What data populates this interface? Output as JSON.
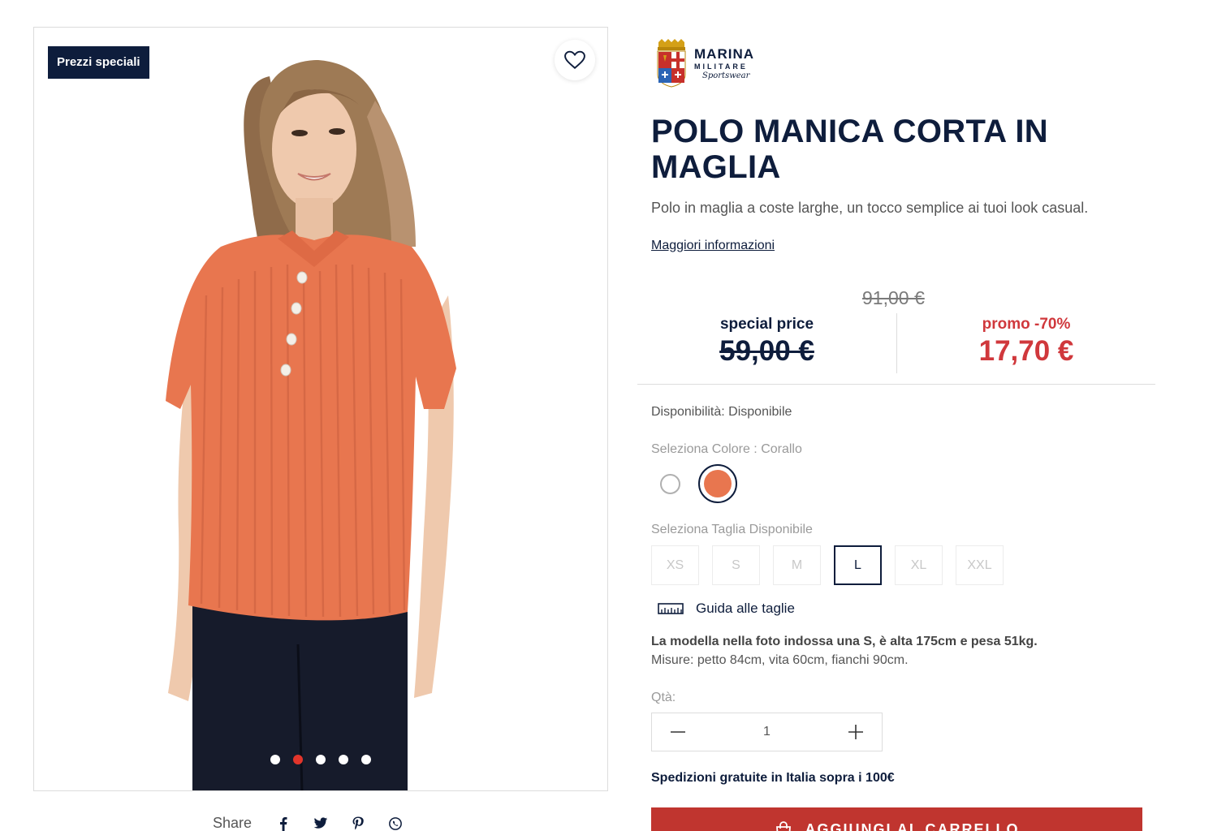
{
  "badge": "Prezzi speciali",
  "gallery": {
    "slide_count": 5,
    "active_index": 1
  },
  "share": {
    "label": "Share",
    "icons": [
      "facebook-icon",
      "twitter-icon",
      "pinterest-icon",
      "whatsapp-icon"
    ]
  },
  "brand": {
    "name": "MARINA",
    "sub": "MILITARE",
    "script": "Sportswear"
  },
  "product": {
    "title": "POLO MANICA CORTA IN MAGLIA",
    "description": "Polo in maglia a coste larghe, un tocco semplice ai tuoi look casual.",
    "more_info": "Maggiori informazioni"
  },
  "price": {
    "original": "91,00 €",
    "special_label": "special price",
    "special_value": "59,00 €",
    "promo_label": "promo -70%",
    "promo_value": "17,70 €"
  },
  "availability": "Disponibilità: Disponibile",
  "color": {
    "label": "Seleziona Colore : Corallo",
    "options": [
      {
        "name": "white",
        "hex": "#ffffff"
      },
      {
        "name": "coral",
        "hex": "#e8764f"
      }
    ],
    "selected": "coral"
  },
  "size": {
    "label": "Seleziona Taglia Disponibile",
    "options": [
      "XS",
      "S",
      "M",
      "L",
      "XL",
      "XXL"
    ],
    "selected": "L"
  },
  "size_guide": "Guida alle taglie",
  "model_info": "La modella nella foto indossa una S, è alta 175cm e pesa 51kg.",
  "measures": "Misure: petto 84cm, vita 60cm, fianchi 90cm.",
  "quantity": {
    "label": "Qtà:",
    "value": "1"
  },
  "shipping": "Spedizioni gratuite in Italia sopra i 100€",
  "add_to_cart": "AGGIUNGI AL CARRELLO",
  "colors": {
    "navy": "#0e1d3c",
    "red": "#d0383c",
    "button_red": "#c0352f",
    "coral": "#e8764f"
  }
}
